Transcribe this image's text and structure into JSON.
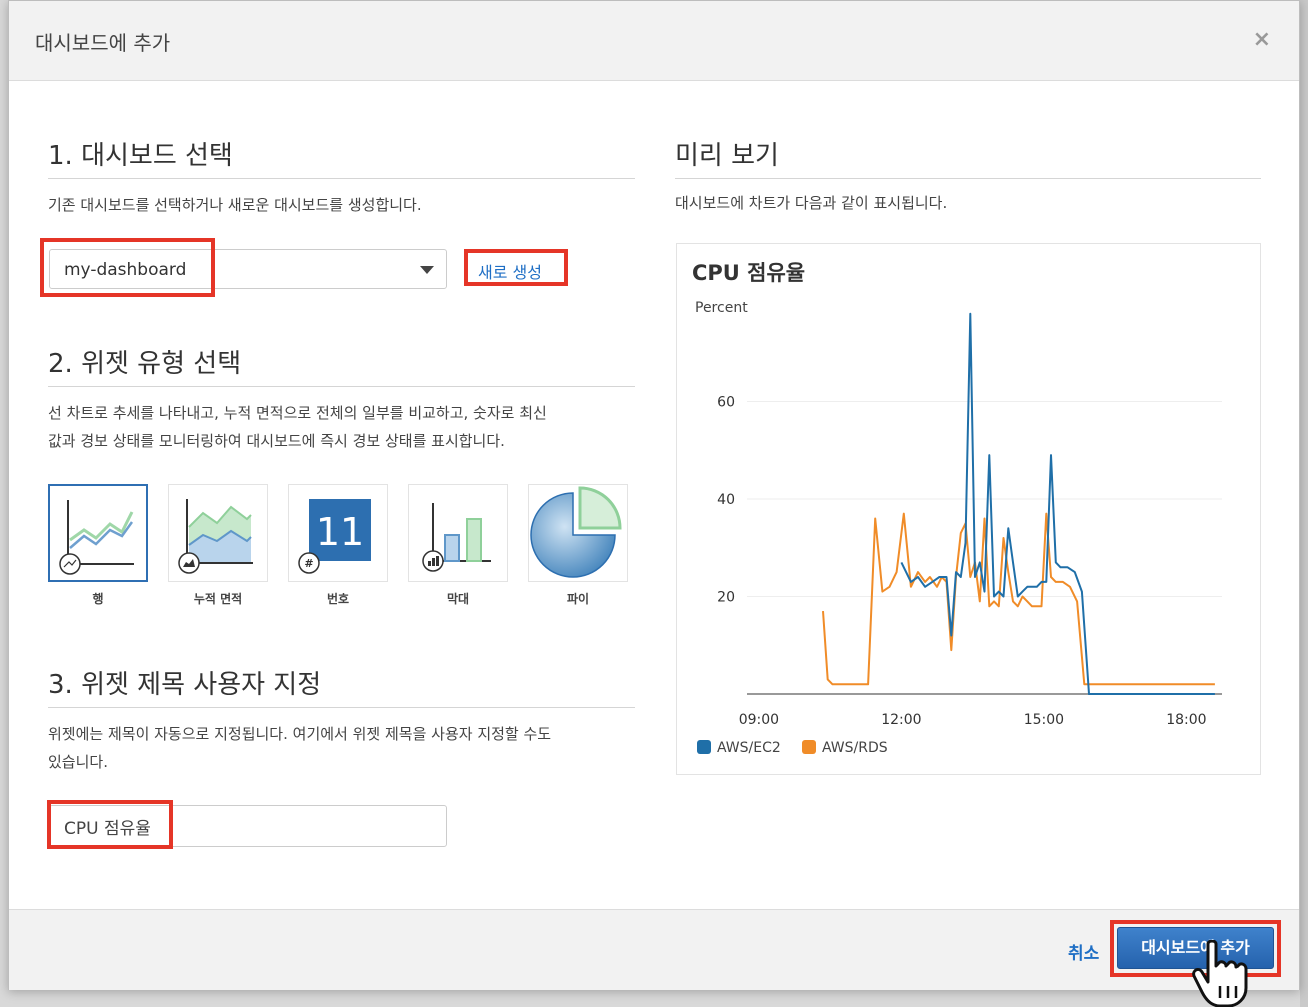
{
  "modal": {
    "title": "대시보드에 추가",
    "close": "×"
  },
  "step1": {
    "title": "1. 대시보드 선택",
    "description": "기존 대시보드를 선택하거나 새로운 대시보드를 생성합니다.",
    "selected_dashboard": "my-dashboard",
    "new_link": "새로 생성"
  },
  "step2": {
    "title": "2. 위젯 유형 선택",
    "description_line1": "선 차트로 추세를 나타내고, 누적 면적으로 전체의 일부를 비교하고, 숫자로 최신",
    "description_line2": "값과 경보 상태를 모니터링하여 대시보드에 즉시 경보 상태를 표시합니다.",
    "widgets": [
      {
        "label": "행",
        "icon": "line-chart-icon",
        "selected": true
      },
      {
        "label": "누적 면적",
        "icon": "stacked-area-icon",
        "selected": false
      },
      {
        "label": "번호",
        "icon": "number-icon",
        "selected": false,
        "number": "11"
      },
      {
        "label": "막대",
        "icon": "bar-chart-icon",
        "selected": false
      },
      {
        "label": "파이",
        "icon": "pie-chart-icon",
        "selected": false
      }
    ]
  },
  "step3": {
    "title": "3. 위젯 제목 사용자 지정",
    "description_line1": "위젯에는 제목이 자동으로 지정됩니다. 여기에서 위젯 제목을 사용자 지정할 수도",
    "description_line2": "있습니다.",
    "title_value": "CPU 점유율"
  },
  "preview": {
    "title": "미리 보기",
    "description": "대시보드에 차트가 다음과 같이 표시됩니다."
  },
  "chart_data": {
    "type": "line",
    "title": "CPU 점유율",
    "ylabel": "Percent",
    "xlabel": "",
    "xlim": [
      8.75,
      18.75
    ],
    "ylim": [
      0,
      80
    ],
    "yticks": [
      20,
      40,
      60
    ],
    "xticks": [
      9,
      12,
      15,
      18
    ],
    "xtick_labels": [
      "09:00",
      "12:00",
      "15:00",
      "18:00"
    ],
    "grid": true,
    "legend_position": "bottom-left",
    "series": [
      {
        "name": "AWS/EC2",
        "color": "#1f6fa8",
        "x": [
          12.0,
          12.2,
          12.35,
          12.5,
          12.65,
          12.8,
          12.95,
          13.05,
          13.15,
          13.25,
          13.35,
          13.45,
          13.55,
          13.65,
          13.75,
          13.85,
          13.95,
          14.05,
          14.15,
          14.25,
          14.35,
          14.45,
          14.55,
          14.65,
          14.75,
          14.85,
          14.95,
          15.05,
          15.15,
          15.25,
          15.35,
          15.5,
          15.65,
          15.8,
          15.95,
          16.1,
          16.3,
          16.6,
          17.0,
          17.5,
          18.0,
          18.6
        ],
        "y": [
          27,
          23,
          24,
          22,
          23,
          24,
          24,
          12,
          25,
          24,
          31,
          78,
          24,
          27,
          21,
          49,
          20,
          21,
          20,
          34,
          27,
          20,
          21,
          22,
          22,
          22,
          23,
          23,
          49,
          27,
          26,
          26,
          25,
          21,
          0,
          0,
          0,
          0,
          0,
          0,
          0,
          0
        ]
      },
      {
        "name": "AWS/RDS",
        "color": "#f08c28",
        "x": [
          10.35,
          10.45,
          10.55,
          10.7,
          11.0,
          11.3,
          11.45,
          11.6,
          11.75,
          11.9,
          12.05,
          12.2,
          12.35,
          12.5,
          12.6,
          12.75,
          12.85,
          12.95,
          13.05,
          13.15,
          13.25,
          13.35,
          13.45,
          13.55,
          13.65,
          13.75,
          13.85,
          13.95,
          14.05,
          14.15,
          14.25,
          14.35,
          14.45,
          14.55,
          14.65,
          14.75,
          14.85,
          14.95,
          15.05,
          15.15,
          15.25,
          15.4,
          15.55,
          15.7,
          15.85,
          15.95,
          16.1,
          16.4,
          16.8,
          17.3,
          17.8,
          18.6
        ],
        "y": [
          17,
          3,
          2,
          2,
          2,
          2,
          36,
          21,
          22,
          25,
          37,
          22,
          25,
          23,
          24,
          22,
          24,
          23,
          9,
          24,
          33,
          35,
          24,
          27,
          19,
          36,
          18,
          19,
          18,
          32,
          25,
          19,
          18,
          20,
          19,
          18,
          18,
          18,
          37,
          24,
          23,
          23,
          22,
          19,
          2,
          2,
          2,
          2,
          2,
          2,
          2,
          2
        ]
      }
    ]
  },
  "footer": {
    "cancel": "취소",
    "submit": "대시보드에 추가"
  },
  "colors": {
    "highlight": "#e53527",
    "link": "#1f6fc5",
    "primary": "#2f6fb3"
  }
}
